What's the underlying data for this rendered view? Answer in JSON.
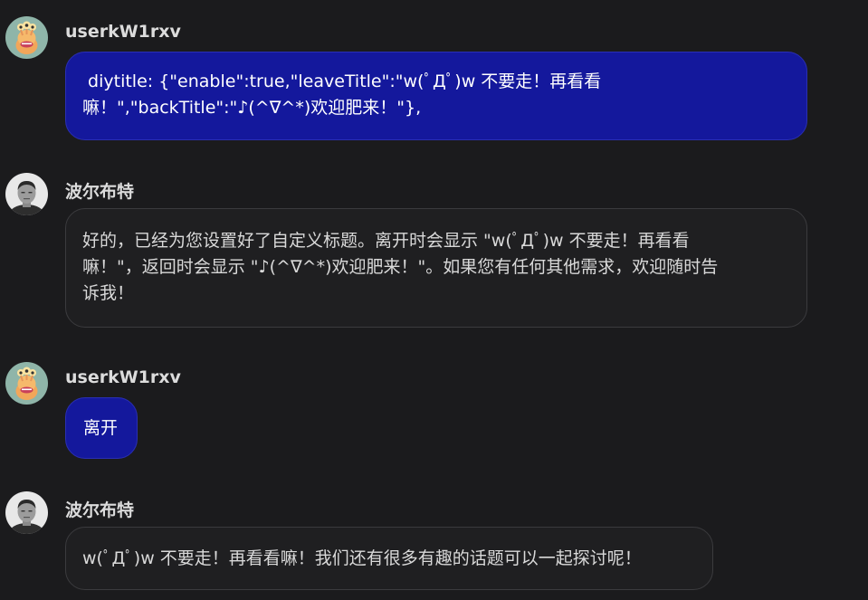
{
  "messages": [
    {
      "role": "user",
      "username": "userkW1rxv",
      "avatar": "alien-avatar-icon",
      "text": " diytitle: {\"enable\":true,\"leaveTitle\":\"w(ﾟДﾟ)w 不要走！再看看\n嘛！\",\"backTitle\":\"♪(^∇^*)欢迎肥来！\"},"
    },
    {
      "role": "bot",
      "username": "波尔布特",
      "avatar": "portrait-avatar-icon",
      "text": "好的，已经为您设置好了自定义标题。离开时会显示 \"w(ﾟДﾟ)w 不要走！再看看\n嘛！\"，返回时会显示 \"♪(^∇^*)欢迎肥来！\"。如果您有任何其他需求，欢迎随时告\n诉我！"
    },
    {
      "role": "user",
      "username": "userkW1rxv",
      "avatar": "alien-avatar-icon",
      "text": "离开"
    },
    {
      "role": "bot",
      "username": "波尔布特",
      "avatar": "portrait-avatar-icon",
      "text": "w(ﾟДﾟ)w 不要走！再看看嘛！我们还有很多有趣的话题可以一起探讨呢！"
    }
  ],
  "colors": {
    "background": "#1b1b1d",
    "user_bubble": "#14189c",
    "bot_bubble": "#1f1f21"
  }
}
